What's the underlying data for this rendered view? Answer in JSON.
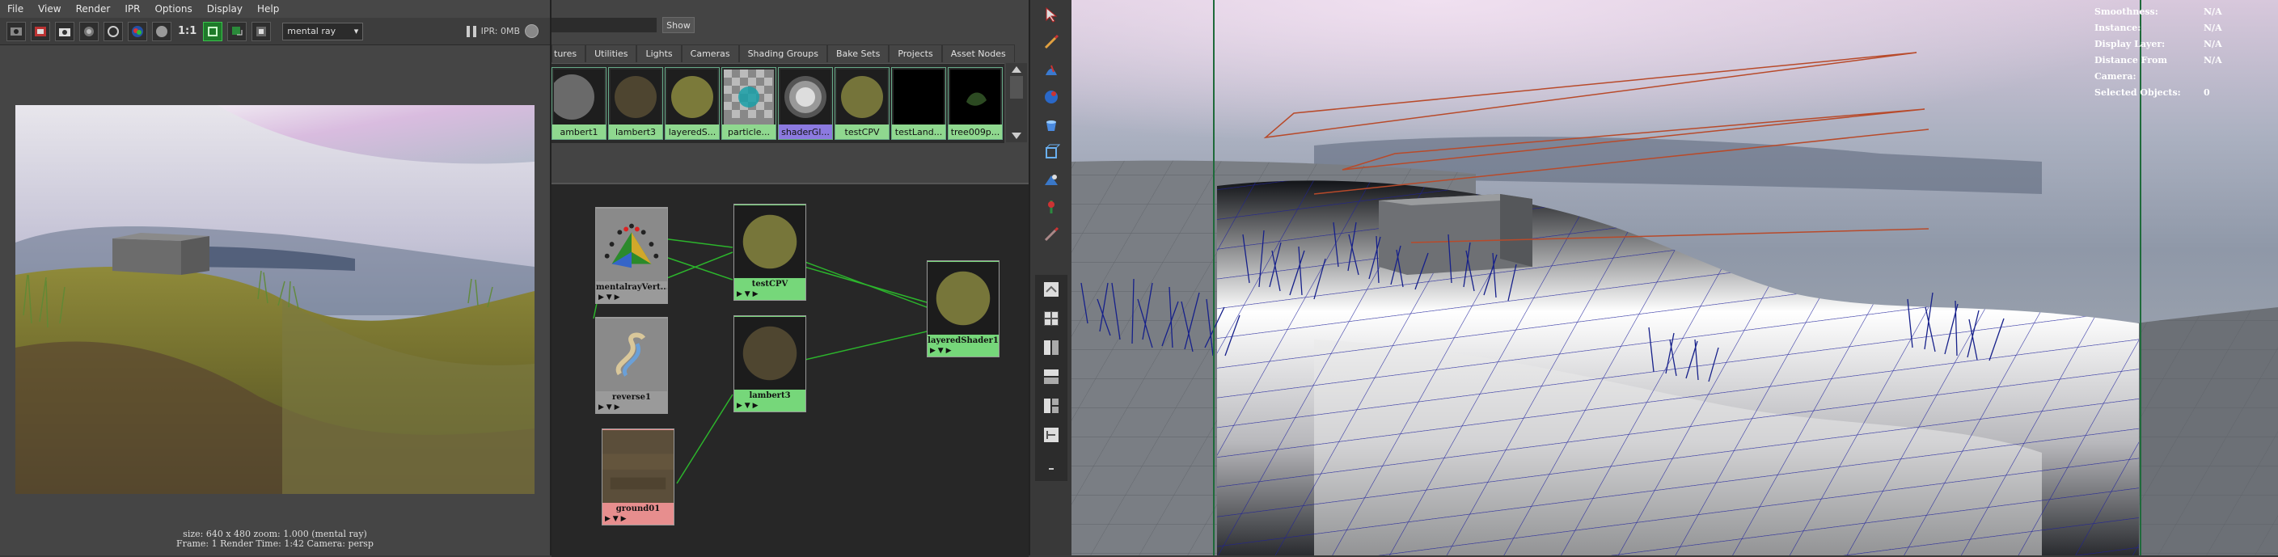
{
  "render_view": {
    "menu": [
      "File",
      "View",
      "Render",
      "IPR",
      "Options",
      "Display",
      "Help"
    ],
    "toolbar": {
      "ratio_label": "1:1",
      "renderer": "mental ray"
    },
    "ipr_label": "IPR: 0MB",
    "info": {
      "line1": "size: 640 x 480  zoom: 1.000        (mental ray)",
      "line2": "Frame: 1        Render Time: 1:42        Camera: persp"
    }
  },
  "hypershade": {
    "show_label": "Show",
    "tabs": [
      "tures",
      "Utilities",
      "Lights",
      "Cameras",
      "Shading Groups",
      "Bake Sets",
      "Projects",
      "Asset Nodes"
    ],
    "swatches": [
      "ambert1",
      "lambert3",
      "layeredS...",
      "particle...",
      "shaderGl...",
      "testCPV",
      "testLand...",
      "tree009p..."
    ],
    "nodes": {
      "mentalray": "mentalrayVert...",
      "reverse": "reverse1",
      "ground": "ground01",
      "testcpv": "testCPV",
      "lambert3": "lambert3",
      "layered": "layeredShader1",
      "ports": "▶  ▼  ▶"
    }
  },
  "tool_icons": [
    "select-arrow-icon",
    "paint-brush-icon",
    "sculpt-icon",
    "sphere-icon",
    "bucket-icon",
    "cube-icon",
    "move-icon",
    "paint-effects-icon",
    "brush-icon",
    "layout-single-icon",
    "layout-four-icon",
    "layout-two-icon",
    "layout-stack-icon",
    "layout-split-icon",
    "layout-tree-icon",
    "more-icon"
  ],
  "viewport": {
    "hud": [
      {
        "key": "Smoothness:",
        "value": "N/A"
      },
      {
        "key": "Instance:",
        "value": "N/A"
      },
      {
        "key": "Display Layer:",
        "value": "N/A"
      },
      {
        "key": "Distance From Camera:",
        "value": "N/A"
      },
      {
        "key": "Selected Objects:",
        "value": "0"
      }
    ]
  }
}
